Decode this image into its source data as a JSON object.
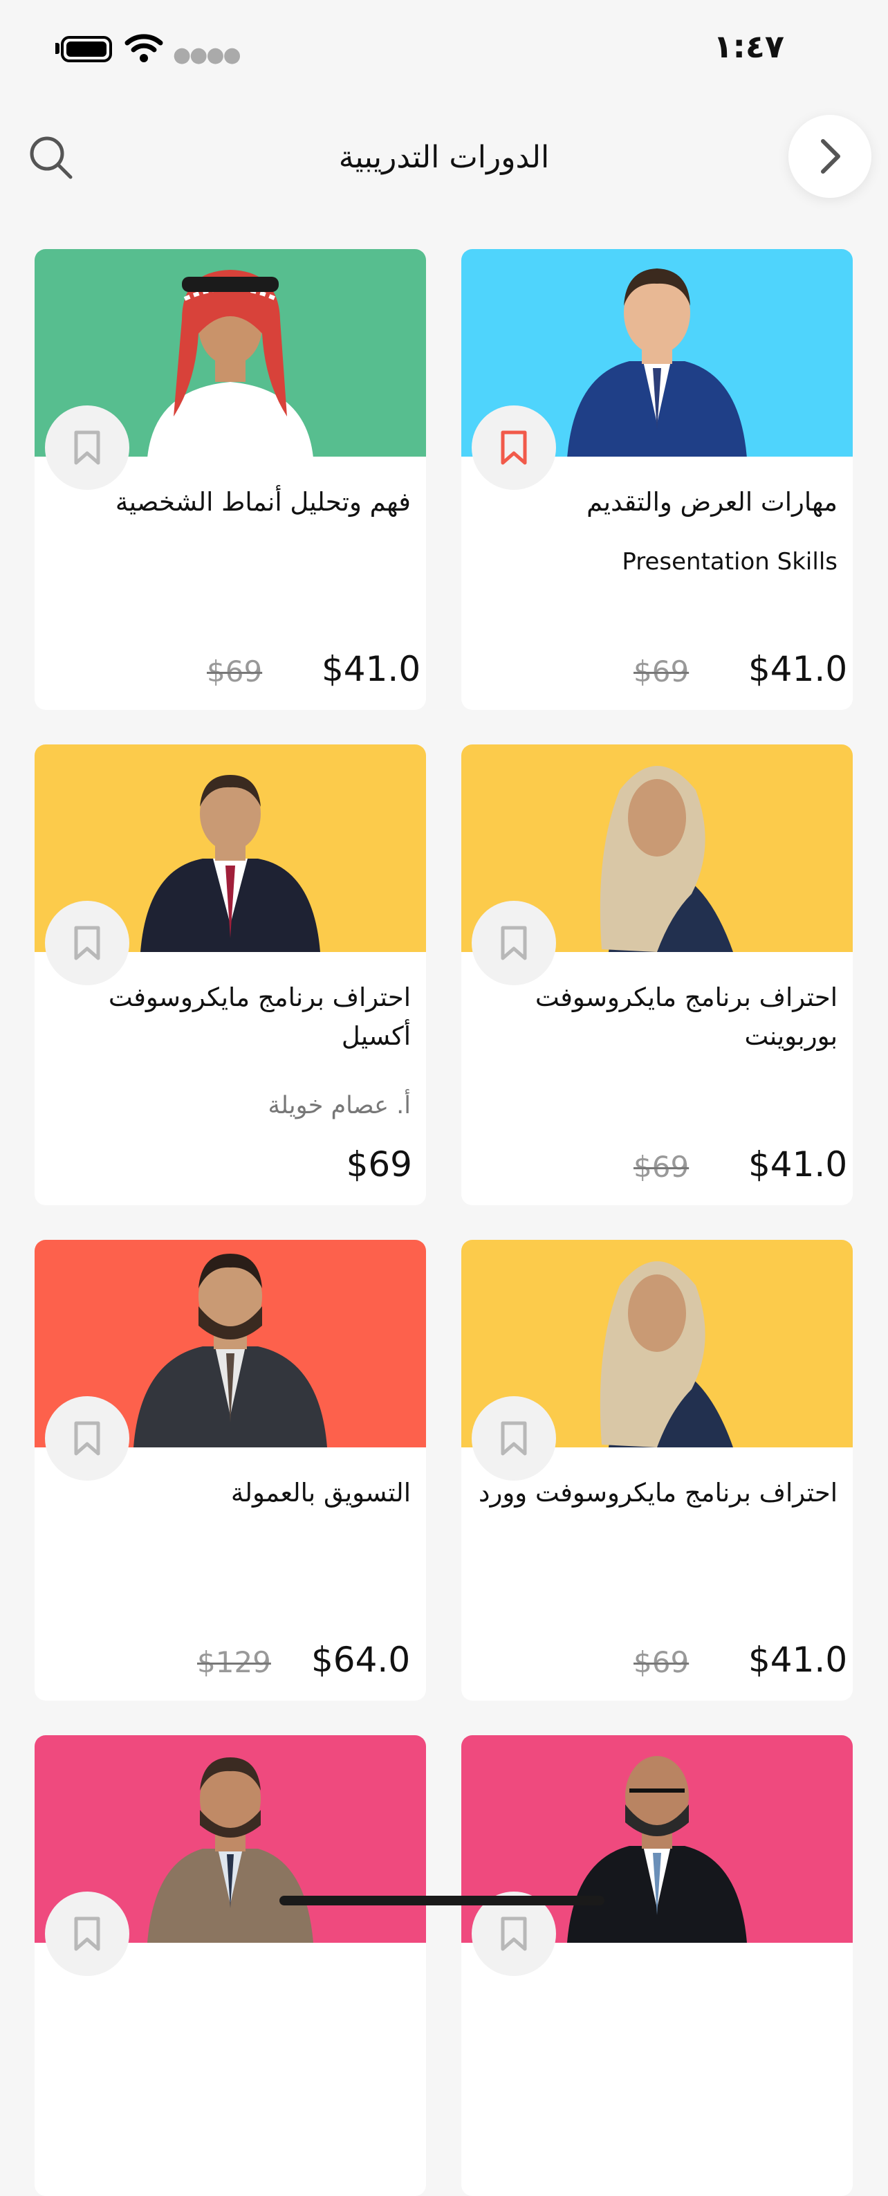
{
  "status_bar": {
    "time": "١:٤٧"
  },
  "header": {
    "title": "الدورات التدريبية"
  },
  "colors": {
    "green": "#57be8f",
    "cyan": "#4fd4fc",
    "yellow": "#fccb4b",
    "orange": "#fd614c",
    "pink": "#ef4a7e",
    "bookmark_active": "#f15a4a",
    "bookmark_inactive": "#b8b8b8"
  },
  "courses": [
    {
      "title": "مهارات العرض والتقديم",
      "subtitle": "Presentation Skills",
      "price": "$41.0",
      "old_price": "$69",
      "bookmarked": true
    },
    {
      "title": "فهم وتحليل أنماط الشخصية",
      "price": "$41.0",
      "old_price": "$69",
      "bookmarked": false
    },
    {
      "title": "احتراف برنامج مايكروسوفت بوربوينت",
      "price": "$41.0",
      "old_price": "$69",
      "bookmarked": false
    },
    {
      "title": "احتراف برنامج مايكروسوفت أكسيل",
      "instructor": "أ. عصام خويلة",
      "price": "$69",
      "bookmarked": false
    },
    {
      "title": "احتراف برنامج مايكروسوفت وورد",
      "price": "$41.0",
      "old_price": "$69",
      "bookmarked": false
    },
    {
      "title": "التسويق بالعمولة",
      "price": "$64.0",
      "old_price": "$129",
      "bookmarked": false
    }
  ]
}
